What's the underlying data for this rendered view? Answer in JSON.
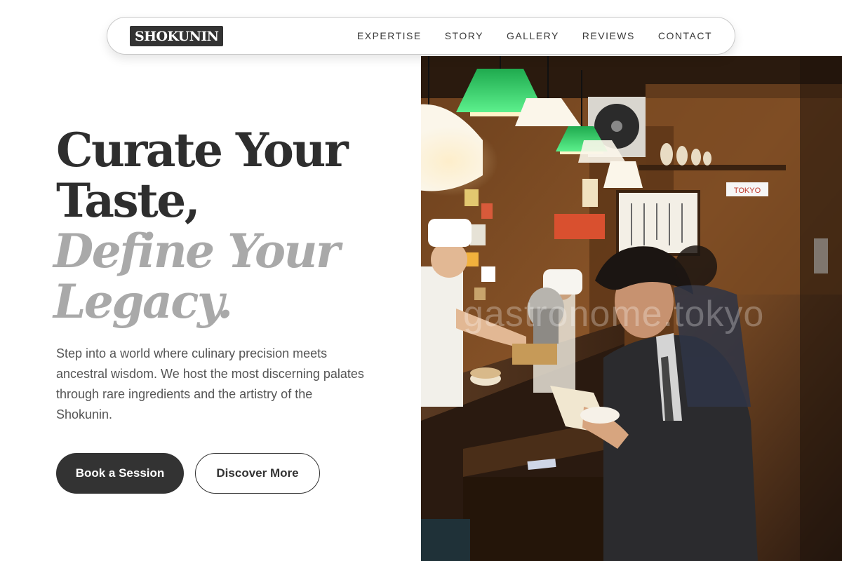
{
  "nav": {
    "logo": "SHOKUNIN",
    "links": [
      {
        "label": "EXPERTISE"
      },
      {
        "label": "STORY"
      },
      {
        "label": "GALLERY"
      },
      {
        "label": "REVIEWS"
      },
      {
        "label": "CONTACT"
      }
    ]
  },
  "hero": {
    "title_line1": "Curate Your",
    "title_line2": "Taste,",
    "accent_line1": "Define Your",
    "accent_line2": "Legacy.",
    "description": "Step into a world where culinary precision meets ancestral wisdom. We host the most discerning palates through rare ingredients and the artistry of the Shokunin.",
    "primary_button": "Book a Session",
    "secondary_button": "Discover More",
    "image": {
      "subject": "izakaya-counter-diners-photo",
      "watermark": "gastronome.tokyo",
      "signage": [
        "TOKYO"
      ]
    }
  },
  "colors": {
    "text_dark": "#333333",
    "accent_grey": "#a9a9a9",
    "body_text": "#555555",
    "button_dark": "#333333",
    "lamp_green": "#2fd36a"
  }
}
